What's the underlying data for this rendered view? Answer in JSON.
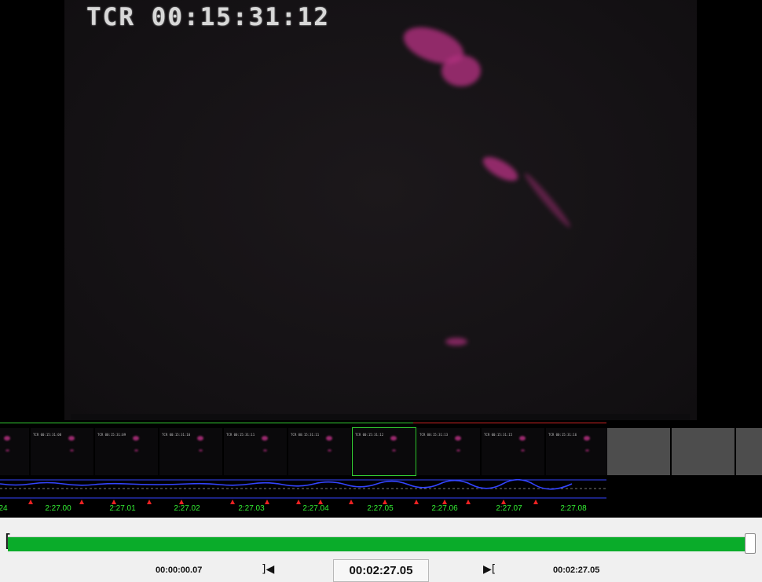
{
  "video": {
    "timecode_overlay": "TCR 00:15:31:12"
  },
  "filmstrip": {
    "thumbnails": [
      {
        "tc": ""
      },
      {
        "tc": "TCR 00:15:31:08"
      },
      {
        "tc": "TCR 00:15:31:09"
      },
      {
        "tc": "TCR 00:15:31:10"
      },
      {
        "tc": "TCR 00:15:31:11"
      },
      {
        "tc": "TCR 00:15:31:11"
      },
      {
        "tc": "TCR 00:15:31:12"
      },
      {
        "tc": "TCR 00:15:31:13"
      },
      {
        "tc": "TCR 00:15:31:15"
      },
      {
        "tc": "TCR 00:15:31:16"
      }
    ],
    "selected_index": 6,
    "time_labels": [
      "24",
      "2:27.00",
      "2:27.01",
      "2:27.02",
      "2:27.03",
      "2:27.04",
      "2:27.05",
      "2:27.06",
      "2:27.07",
      "2:27.08"
    ],
    "colors": {
      "label": "#33ee33",
      "marker": "#ee2222",
      "waveform": "#3344ff",
      "selected": "#33cc33"
    }
  },
  "controls": {
    "in_time": "00:00:00.07",
    "current_time": "00:02:27.05",
    "out_time": "00:02:27.05",
    "prev_frame_icon": "]◀",
    "next_frame_icon": "▶[",
    "progress_fraction": 1.0,
    "progress_color": "#0aac2a"
  }
}
